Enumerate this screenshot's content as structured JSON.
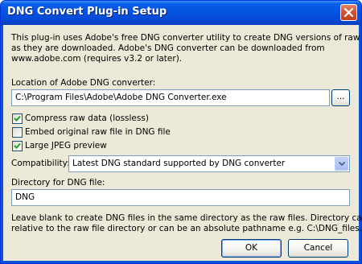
{
  "window": {
    "title": "DNG Convert Plug-in Setup",
    "close_icon": "close-icon"
  },
  "intro": {
    "line1": "This plug-in uses Adobe's free DNG converter utility to create DNG versions of raw files",
    "line2": "as they are downloaded. Adobe's DNG converter can be downloaded from",
    "line3": "www.adobe.com (requires v3.2 or later)."
  },
  "converter": {
    "label": "Location of Adobe DNG converter:",
    "path": "C:\\Program Files\\Adobe\\Adobe DNG Converter.exe",
    "browse_label": "..."
  },
  "options": {
    "compress": {
      "label": "Compress raw data (lossless)",
      "checked": true
    },
    "embed": {
      "label": "Embed original raw file in DNG file",
      "checked": false
    },
    "preview": {
      "label": "Large JPEG preview",
      "checked": true
    }
  },
  "compatibility": {
    "label": "Compatibility:",
    "selected": "Latest DNG standard supported by DNG converter"
  },
  "directory": {
    "label": "Directory for DNG file:",
    "value": "DNG",
    "help1": "Leave blank to create DNG files in the same directory as the raw files. Directory can be",
    "help2": "relative to the raw file directory or can be an absolute pathname e.g. C:\\DNG_files."
  },
  "buttons": {
    "ok": "OK",
    "cancel": "Cancel"
  }
}
